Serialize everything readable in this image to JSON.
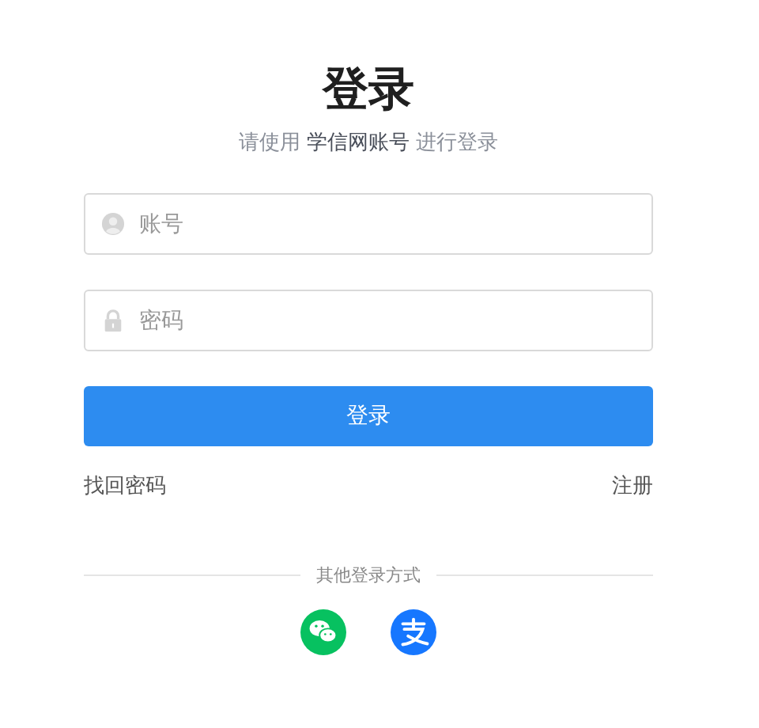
{
  "title": "登录",
  "subtitle": {
    "before": "请使用",
    "highlight": "学信网账号",
    "after": "进行登录"
  },
  "fields": [
    {
      "kind": "account",
      "placeholder": "账号"
    },
    {
      "kind": "password",
      "placeholder": "密码"
    }
  ],
  "submit": "登录",
  "links": {
    "forgot": "找回密码",
    "register": "注册"
  },
  "other": {
    "label": "其他登录方式",
    "methods": [
      {
        "kind": "wechat",
        "color": "#07c160"
      },
      {
        "kind": "alipay",
        "color": "#1677ff"
      }
    ]
  }
}
